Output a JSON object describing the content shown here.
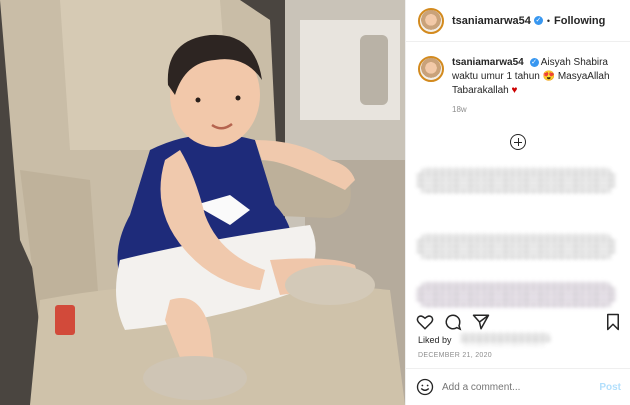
{
  "header": {
    "username": "tsaniamarwa54",
    "verified_mark": "✓",
    "separator": "•",
    "follow_label": "Following"
  },
  "caption": {
    "username": "tsaniamarwa54",
    "text": "Aisyah Shabira waktu umur 1 tahun 😍 MasyaAllah Tabarakallah",
    "heart": "♥",
    "timestamp": "18w"
  },
  "likes": {
    "prefix": "Liked by"
  },
  "post_date": "DECEMBER 21, 2020",
  "comment": {
    "placeholder": "Add a comment...",
    "post_label": "Post"
  },
  "icons": {
    "avatar": "profile-avatar",
    "load_more": "plus-circle-icon",
    "like": "heart-icon",
    "comment": "comment-icon",
    "share": "share-icon",
    "save": "bookmark-icon",
    "emoji": "emoji-icon"
  },
  "colors": {
    "verified": "#3897f0",
    "avatar_ring": "#d38a1e",
    "post_button": "#b2dffc",
    "heart": "#cc0000"
  }
}
